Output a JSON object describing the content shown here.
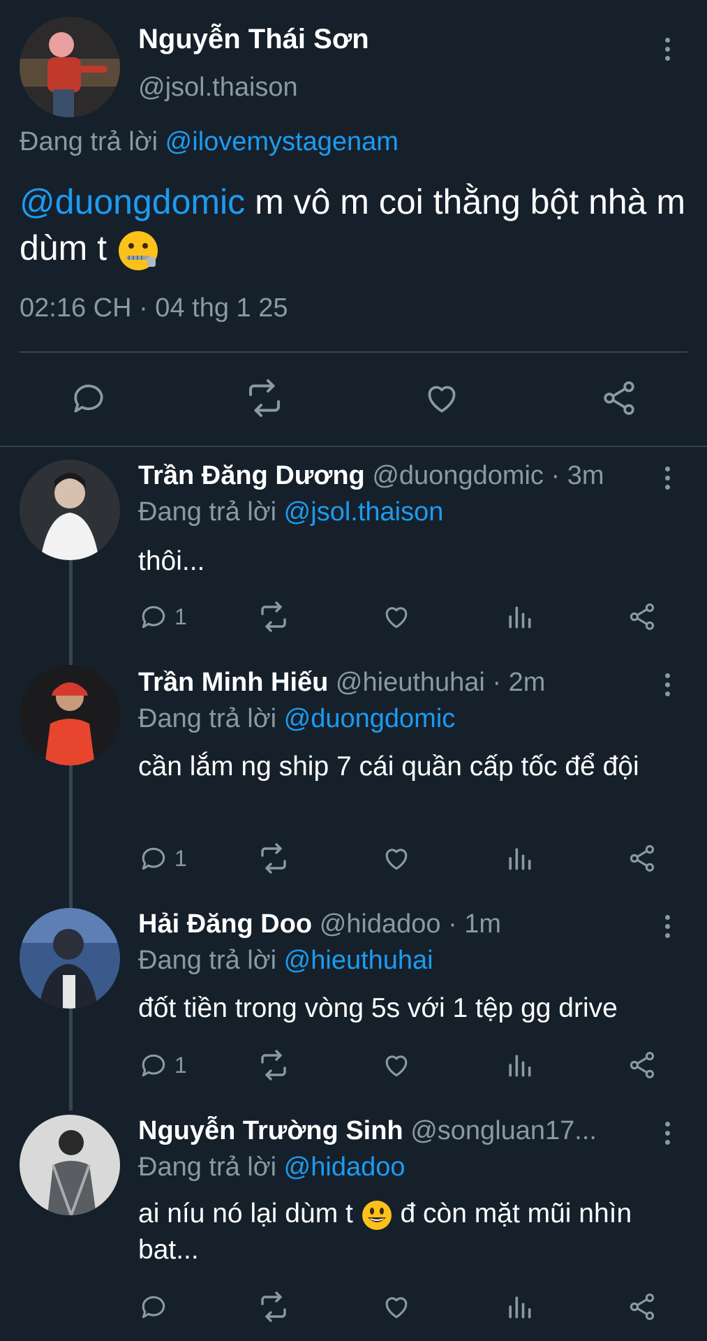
{
  "main_tweet": {
    "name": "Nguyễn Thái Sơn",
    "handle": "@jsol.thaison",
    "replying_label": "Đang trả lời",
    "replying_to": "@ilovemystagenam",
    "mention": "@duongdomic",
    "text_rest": " m vô m coi thằng bột nhà m dùm t",
    "emoji": "zipper-mouth-face",
    "timestamp": "02:16 CH · 04 thg 1 25"
  },
  "replies": [
    {
      "name": "Trần Đăng Dương",
      "handle": "@duongdomic",
      "time": "· 3m",
      "replying_label": "Đang trả lời",
      "replying_to": "@jsol.thaison",
      "text": "thôi...",
      "reply_count": "1",
      "avatar_color": "#8a8f96"
    },
    {
      "name": "Trần Minh Hiếu",
      "handle": "@hieuthuhai",
      "time": "· 2m",
      "replying_label": "Đang trả lời",
      "replying_to": "@duongdomic",
      "text": "cần lắm ng ship 7 cái quần cấp tốc để đội",
      "reply_count": "1",
      "avatar_color": "#c0392b"
    },
    {
      "name": "Hải Đăng Doo",
      "handle": "@hidadoo",
      "time": "· 1m",
      "replying_label": "Đang trả lời",
      "replying_to": "@hieuthuhai",
      "text": "đốt tiền trong vòng 5s với 1 tệp gg drive",
      "reply_count": "1",
      "avatar_color": "#3b5a8a"
    },
    {
      "name": "Nguyễn Trường Sinh",
      "handle": "@songluan17...",
      "time": "",
      "replying_label": "Đang trả lời",
      "replying_to": "@hidadoo",
      "text_before_emoji": "ai níu nó lại dùm t ",
      "emoji": "smiley-face",
      "text_after_emoji": " đ còn mặt mũi nhìn bat...",
      "reply_count": "",
      "avatar_color": "#6b6f73"
    }
  ],
  "colors": {
    "background": "#15202b",
    "link": "#1d9bf0",
    "muted": "#8b98a5",
    "divider": "#38444d"
  }
}
